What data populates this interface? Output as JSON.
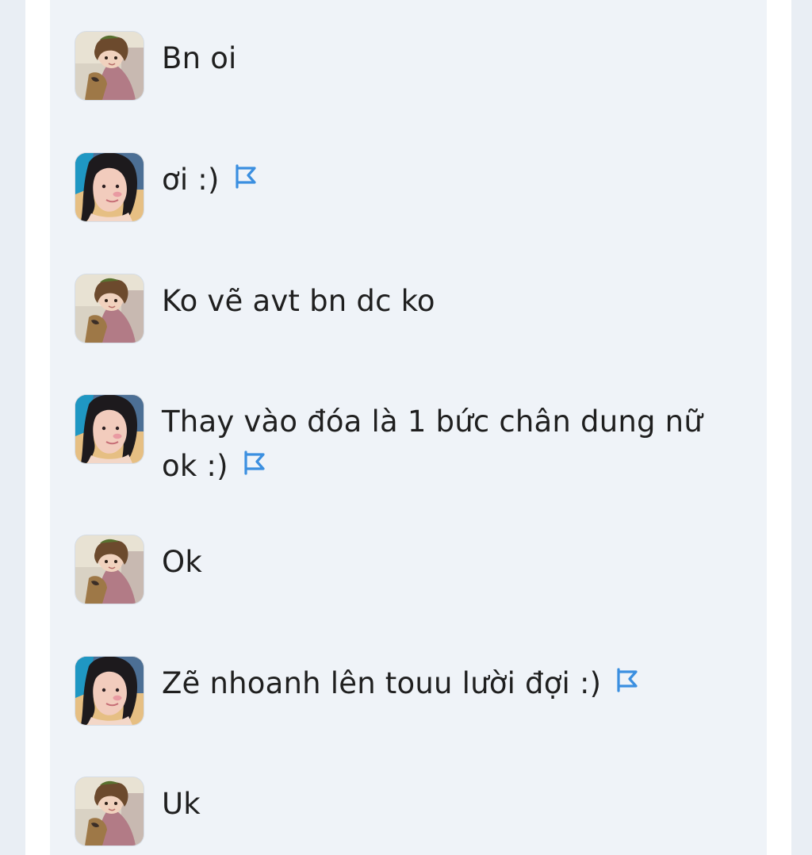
{
  "chat": {
    "messages": [
      {
        "sender": "boy",
        "text": "Bn oi",
        "flag_icon": null
      },
      {
        "sender": "girl",
        "text": "ơi :)",
        "flag_icon": "flag-icon"
      },
      {
        "sender": "boy",
        "text": "Ko vẽ avt bn dc ko",
        "flag_icon": null
      },
      {
        "sender": "girl",
        "text": "Thay vào đóa là 1 bức chân dung nữ ok :)",
        "flag_icon": "flag-icon"
      },
      {
        "sender": "boy",
        "text": "Ok",
        "flag_icon": null
      },
      {
        "sender": "girl",
        "text": "Zẽ nhoanh lên touu lười đợi :)",
        "flag_icon": "flag-icon"
      },
      {
        "sender": "boy",
        "text": "Uk",
        "flag_icon": null
      }
    ]
  },
  "colors": {
    "page_background": "#e9eef4",
    "chat_background": "#eff3f8",
    "text": "#1f1f1f",
    "flag_accent": "#3b8fe0"
  }
}
